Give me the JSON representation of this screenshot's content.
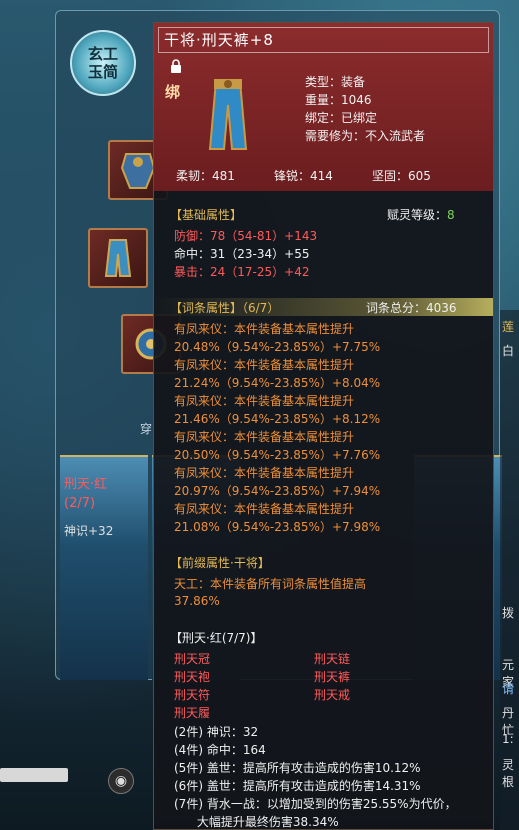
{
  "badge": {
    "line1": "玄工",
    "line2": "玉简"
  },
  "left_card": {
    "title": "刑天·红",
    "count": "(2/7)",
    "stat": "神识+32"
  },
  "left_text": "穿",
  "right_peek": [
    "莲",
    "白",
    "拨",
    "元家",
    "请",
    "丹忙",
    "1:",
    "灵根"
  ],
  "tooltip": {
    "title": "干将·刑天裤+8",
    "bind_tag": "绑",
    "info": [
      {
        "label": "类型：",
        "value": "装备"
      },
      {
        "label": "重量：",
        "value": "1046"
      },
      {
        "label": "绑定：",
        "value": "已绑定"
      },
      {
        "label": "需要修为：",
        "value": "不入流武者"
      }
    ],
    "stats": [
      {
        "label": "柔韧：",
        "value": "481"
      },
      {
        "label": "锋锐：",
        "value": "414"
      },
      {
        "label": "坚固：",
        "value": "605"
      }
    ],
    "base": {
      "header": "【基础属性】",
      "spirit_label": "赋灵等级：",
      "spirit_value": "8",
      "lines": [
        {
          "text": "防御：78（54-81）+143",
          "color": "red"
        },
        {
          "text": "命中：31（23-34）+55",
          "color": "white"
        },
        {
          "text": "暴击：24（17-25）+42",
          "color": "red"
        }
      ]
    },
    "affix": {
      "header": "【词条属性】（6/7）",
      "total_label": "词条总分：",
      "total_value": "4036",
      "items": [
        {
          "name": "有凤来仪：本件装备基本属性提升",
          "value": "20.48%（9.54%-23.85%）+7.75%"
        },
        {
          "name": "有凤来仪：本件装备基本属性提升",
          "value": "21.24%（9.54%-23.85%）+8.04%"
        },
        {
          "name": "有凤来仪：本件装备基本属性提升",
          "value": "21.46%（9.54%-23.85%）+8.12%"
        },
        {
          "name": "有凤来仪：本件装备基本属性提升",
          "value": "20.50%（9.54%-23.85%）+7.76%"
        },
        {
          "name": "有凤来仪：本件装备基本属性提升",
          "value": "20.97%（9.54%-23.85%）+7.94%"
        },
        {
          "name": "有凤来仪：本件装备基本属性提升",
          "value": "21.08%（9.54%-23.85%）+7.98%"
        }
      ]
    },
    "prefix": {
      "header": "【前缀属性·干将】",
      "line1": "天工：本件装备所有词条属性值提高",
      "line2": "37.86%"
    },
    "set": {
      "header": "【刑天·红(7/7)】",
      "pieces_left": [
        "刑天冠",
        "刑天袍",
        "刑天符",
        "刑天履"
      ],
      "pieces_right": [
        "刑天链",
        "刑天裤",
        "刑天戒"
      ],
      "bonuses": [
        "(2件) 神识：32",
        "(4件) 命中：164",
        "(5件) 盖世：提高所有攻击造成的伤害10.12%",
        "(6件) 盖世：提高所有攻击造成的伤害14.31%",
        "(7件) 背水一战：以增加受到的伤害25.55%为代价，",
        "      大幅提升最终伤害38.34%"
      ]
    }
  }
}
